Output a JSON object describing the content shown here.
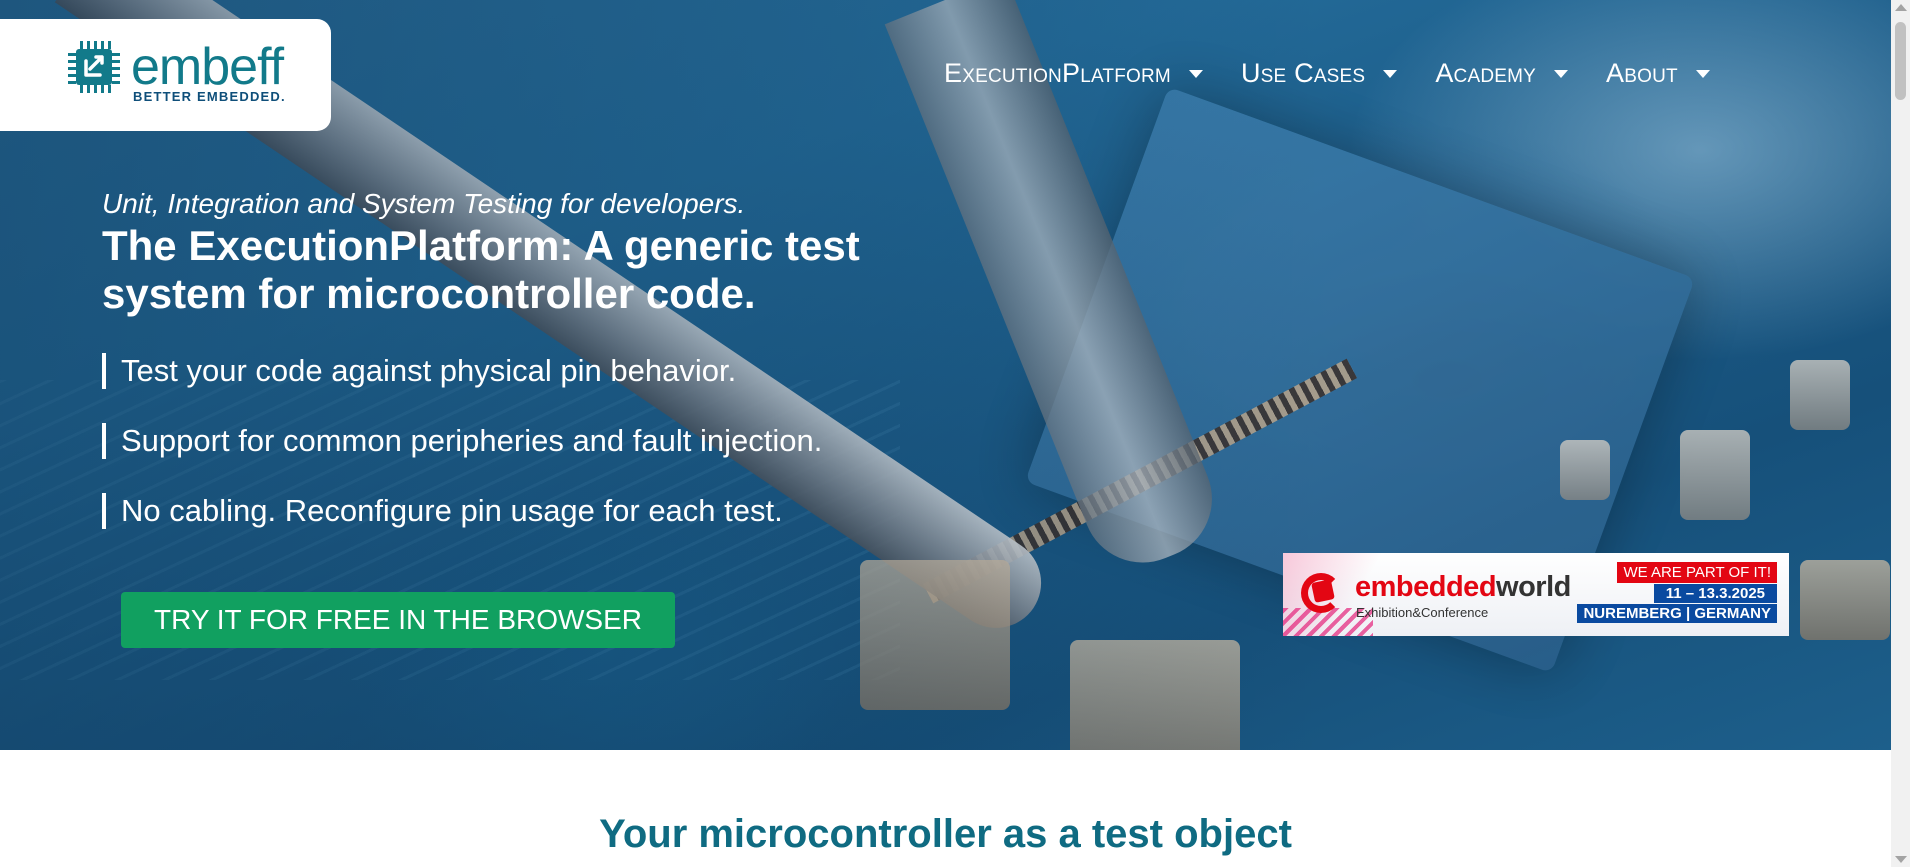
{
  "logo": {
    "wordmark": "embeff",
    "tagline": "BETTER EMBEDDED.",
    "brand_color": "#127a8a"
  },
  "nav": {
    "items": [
      {
        "label": "ExecutionPlatform"
      },
      {
        "label": "Use Cases"
      },
      {
        "label": "Academy"
      },
      {
        "label": "About"
      }
    ]
  },
  "hero": {
    "subtitle": "Unit, Integration and System Testing for developers.",
    "headline": "The ExecutionPlatform: A generic test system for microcontroller code.",
    "bullets": [
      "Test your code against physical pin behavior.",
      "Support for common peripheries and fault injection.",
      "No cabling. Reconfigure pin usage for each test."
    ],
    "cta_label": "TRY IT FOR FREE IN THE BROWSER",
    "cta_color": "#11a060"
  },
  "event_banner": {
    "name_red": "embedded",
    "name_dark": "world",
    "sub": "Exhibition&Conference",
    "badge": "WE ARE PART OF IT!",
    "dates": "11 – 13.3.2025",
    "location": "NUREMBERG | GERMANY"
  },
  "section": {
    "title": "Your microcontroller as a test object"
  }
}
